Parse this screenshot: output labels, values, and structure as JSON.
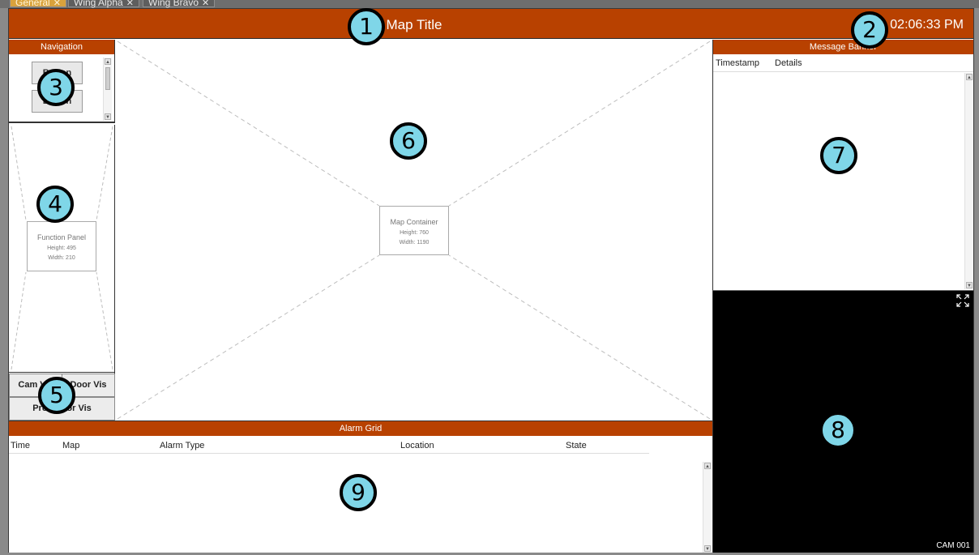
{
  "tabs": [
    {
      "label": "General",
      "active": true
    },
    {
      "label": "Wing Alpha",
      "active": false
    },
    {
      "label": "Wing Bravo",
      "active": false
    }
  ],
  "header": {
    "title": "Map Title",
    "clock": "02:06:33 PM"
  },
  "navigation": {
    "title": "Navigation",
    "buttons": [
      "Button",
      "Button"
    ]
  },
  "function_panel": {
    "title": "Function Panel",
    "height_label": "Height:",
    "height_value": "495",
    "width_label": "Width:",
    "width_value": "210"
  },
  "visibility_buttons": {
    "cam": "Cam Vis",
    "door": "Door Vis",
    "prox": "Prox Door Vis"
  },
  "map_container": {
    "title": "Map Container",
    "height_label": "Height:",
    "height_value": "760",
    "width_label": "Width:",
    "width_value": "1190"
  },
  "message_banner": {
    "title": "Message Banner",
    "columns": [
      "Timestamp",
      "Details"
    ]
  },
  "camera": {
    "label": "CAM 001"
  },
  "alarm_grid": {
    "title": "Alarm Grid",
    "columns": [
      "Time",
      "Map",
      "Alarm Type",
      "Location",
      "State"
    ]
  },
  "markers": [
    "1",
    "2",
    "3",
    "4",
    "5",
    "6",
    "7",
    "8",
    "9"
  ],
  "colors": {
    "accent": "#b84100",
    "marker_fill": "#7fd6e8",
    "camera_bg": "#000000",
    "active_tab": "#d9a23c"
  }
}
